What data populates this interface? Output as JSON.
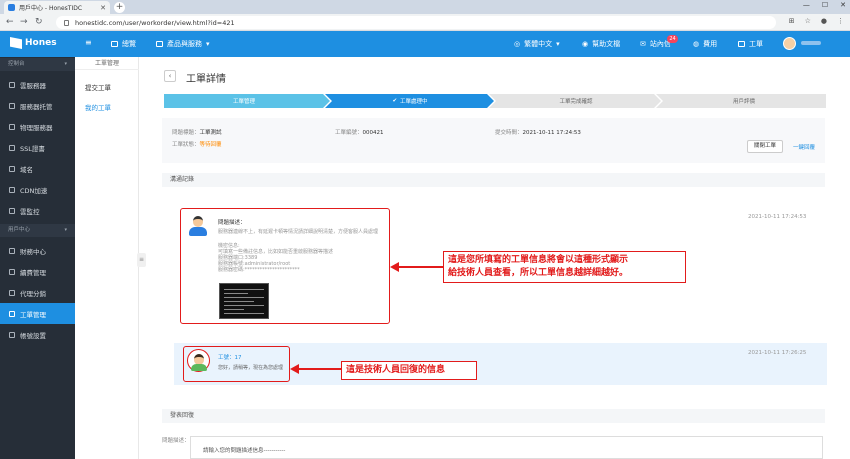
{
  "browser": {
    "tab_title": "用戶中心 - HonesTIDC",
    "url": "honestidc.com/user/workorder/view.html?id=421"
  },
  "topnav": {
    "logo": "Hones",
    "overview": "總覽",
    "products": "產品與服務",
    "language": "繁體中文",
    "help": "幫助文檔",
    "inbox": "站內信",
    "inbox_count": "24",
    "billing": "費用",
    "ticket": "工單"
  },
  "sidebar": {
    "group1": "控制台",
    "items": [
      "雲服務器",
      "服務器托管",
      "物理服務器",
      "SSL證書",
      "域名",
      "CDN加速",
      "雲監控"
    ],
    "group2": "用戶中心",
    "items2": [
      "財務中心",
      "續費管理",
      "代理分銷",
      "工單管理",
      "帳號設置"
    ]
  },
  "subsidebar": {
    "header": "工單管理",
    "items": [
      "提交工單",
      "我的工單"
    ]
  },
  "page": {
    "title": "工單詳情",
    "steps": [
      "工單管理",
      "工單處理中",
      "工單完成確認",
      "用戶評價"
    ]
  },
  "meta": {
    "issue_label": "問題標題：",
    "issue_value": "工單測試",
    "id_label": "工單編號：",
    "id_value": "000421",
    "time_label": "提交時間：",
    "time_value": "2021-10-11 17:24:53",
    "status_label": "工單狀態：",
    "status_value": "等待回覆",
    "close_btn": "關閉工單",
    "reply_link": "一鍵回覆"
  },
  "records": {
    "header": "溝通記錄",
    "user_msg": {
      "title": "問題描述：",
      "lines": [
        "服務器連線不上，有延遲卡頓等情況請詳細說明清楚，方便客服人員處理",
        "機密信息:",
        "可填寫一些備註信息，比如如能否重啟服務器等描述",
        "服務器端口:3389",
        "服務器帳號:administrator/root",
        "服務器密碼:**********************"
      ],
      "time": "2021-10-11 17:24:53"
    },
    "staff_msg": {
      "name": "工號：17",
      "text": "您好，請稍等，現在為您處理",
      "time": "2021-10-11 17:26:25"
    }
  },
  "annotations": {
    "callout1_line1": "這是您所填寫的工單信息將會以這種形式顯示",
    "callout1_line2": "給技術人員查看，所以工單信息越詳細越好。",
    "callout2": "這是技術人員回復的信息"
  },
  "reply": {
    "header": "發表回復",
    "label": "問題描述：",
    "placeholder": "請輸入您的問題描述信息-----------"
  },
  "colors": {
    "brand": "#1e8fe1",
    "step_active": "#1e8fe1",
    "step_done": "#5bc2e7",
    "annotation": "#e21b1b"
  }
}
